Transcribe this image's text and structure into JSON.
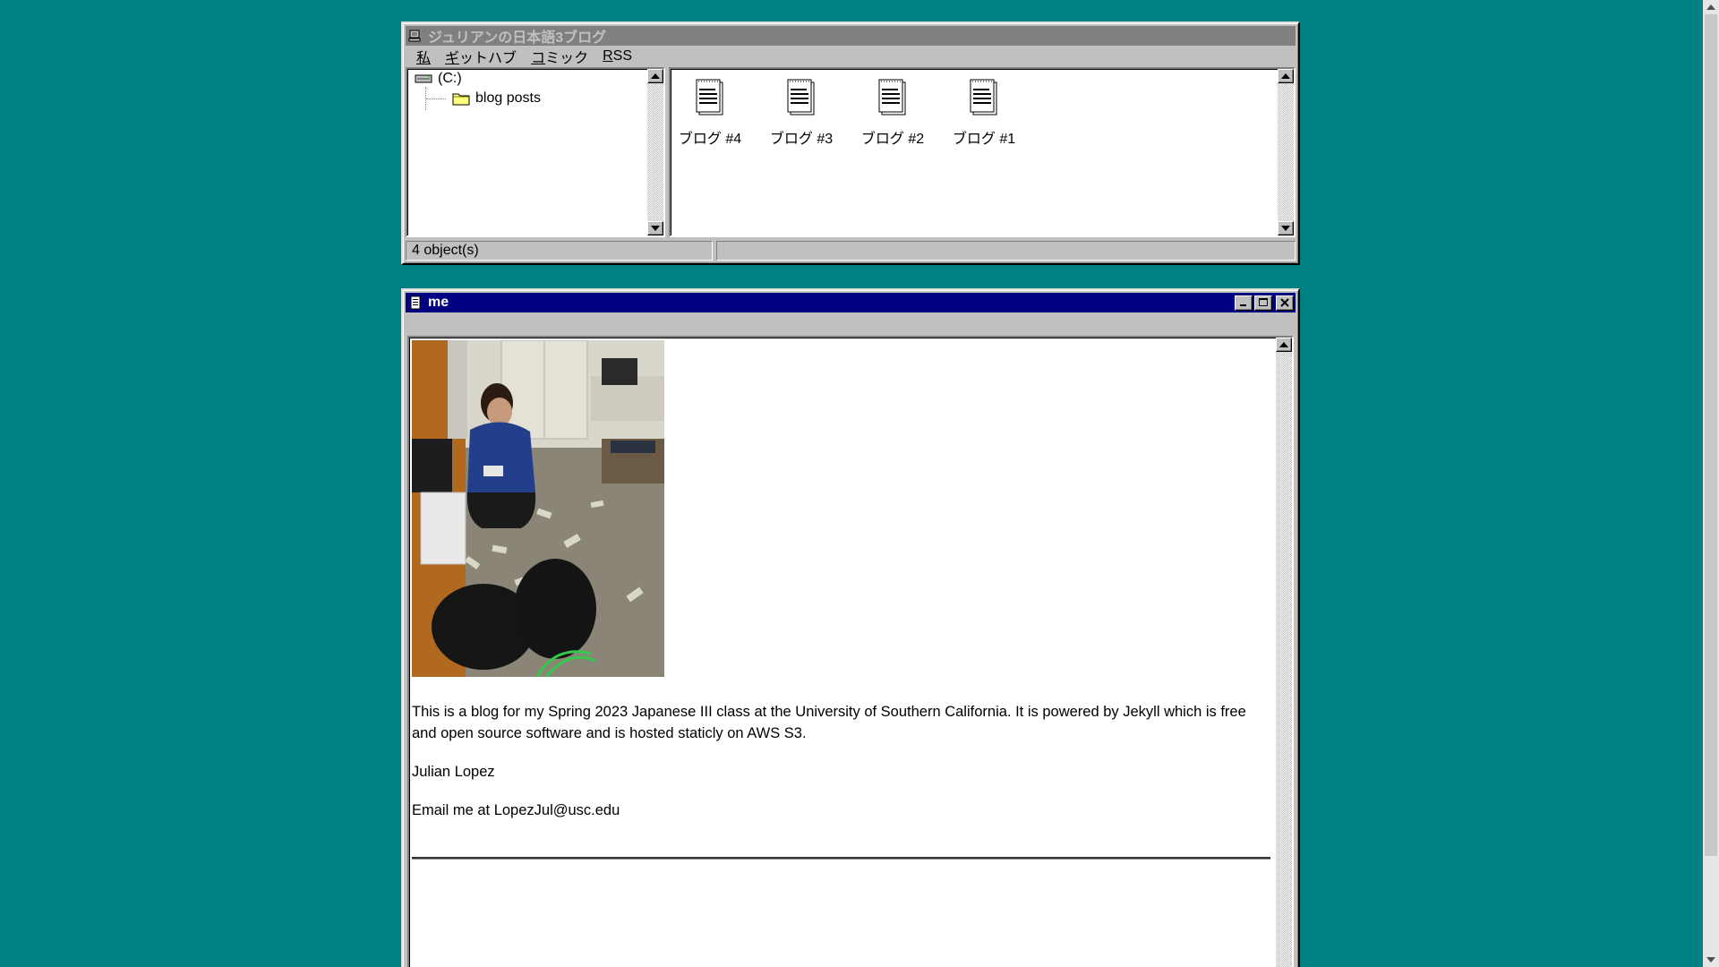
{
  "explorer": {
    "title": "ジュリアンの日本語3ブログ",
    "title_icon": "computer-icon",
    "menu": [
      {
        "label": "私",
        "accel_index": 0
      },
      {
        "label": "ギットハブ",
        "accel_index": 0
      },
      {
        "label": "コミック",
        "accel_index": 0
      },
      {
        "label": "RSS",
        "accel_index": 0
      }
    ],
    "tree": {
      "root_label": "(C:)",
      "root_icon": "drive-icon",
      "child_label": "blog posts",
      "child_icon": "folder-icon"
    },
    "files": [
      {
        "label": "ブログ #4",
        "icon": "document-icon"
      },
      {
        "label": "ブログ #3",
        "icon": "document-icon"
      },
      {
        "label": "ブログ #2",
        "icon": "document-icon"
      },
      {
        "label": "ブログ #1",
        "icon": "document-icon"
      }
    ],
    "status": {
      "objects": "4 object(s)",
      "right": ""
    }
  },
  "me_window": {
    "title": "me",
    "title_icon": "notepad-icon",
    "photo_alt": "Julian Lopez",
    "bio": "This is a blog for my Spring 2023 Japanese III class at the University of Southern California. It is powered by Jekyll which is free and open source software and is hosted staticly on AWS S3.",
    "name": "Julian Lopez",
    "email_line": "Email me at LopezJul@usc.edu"
  },
  "colors": {
    "desktop": "#008080",
    "window_face": "#c0c0c0",
    "active_title": "#000080",
    "inactive_title": "#808080"
  }
}
